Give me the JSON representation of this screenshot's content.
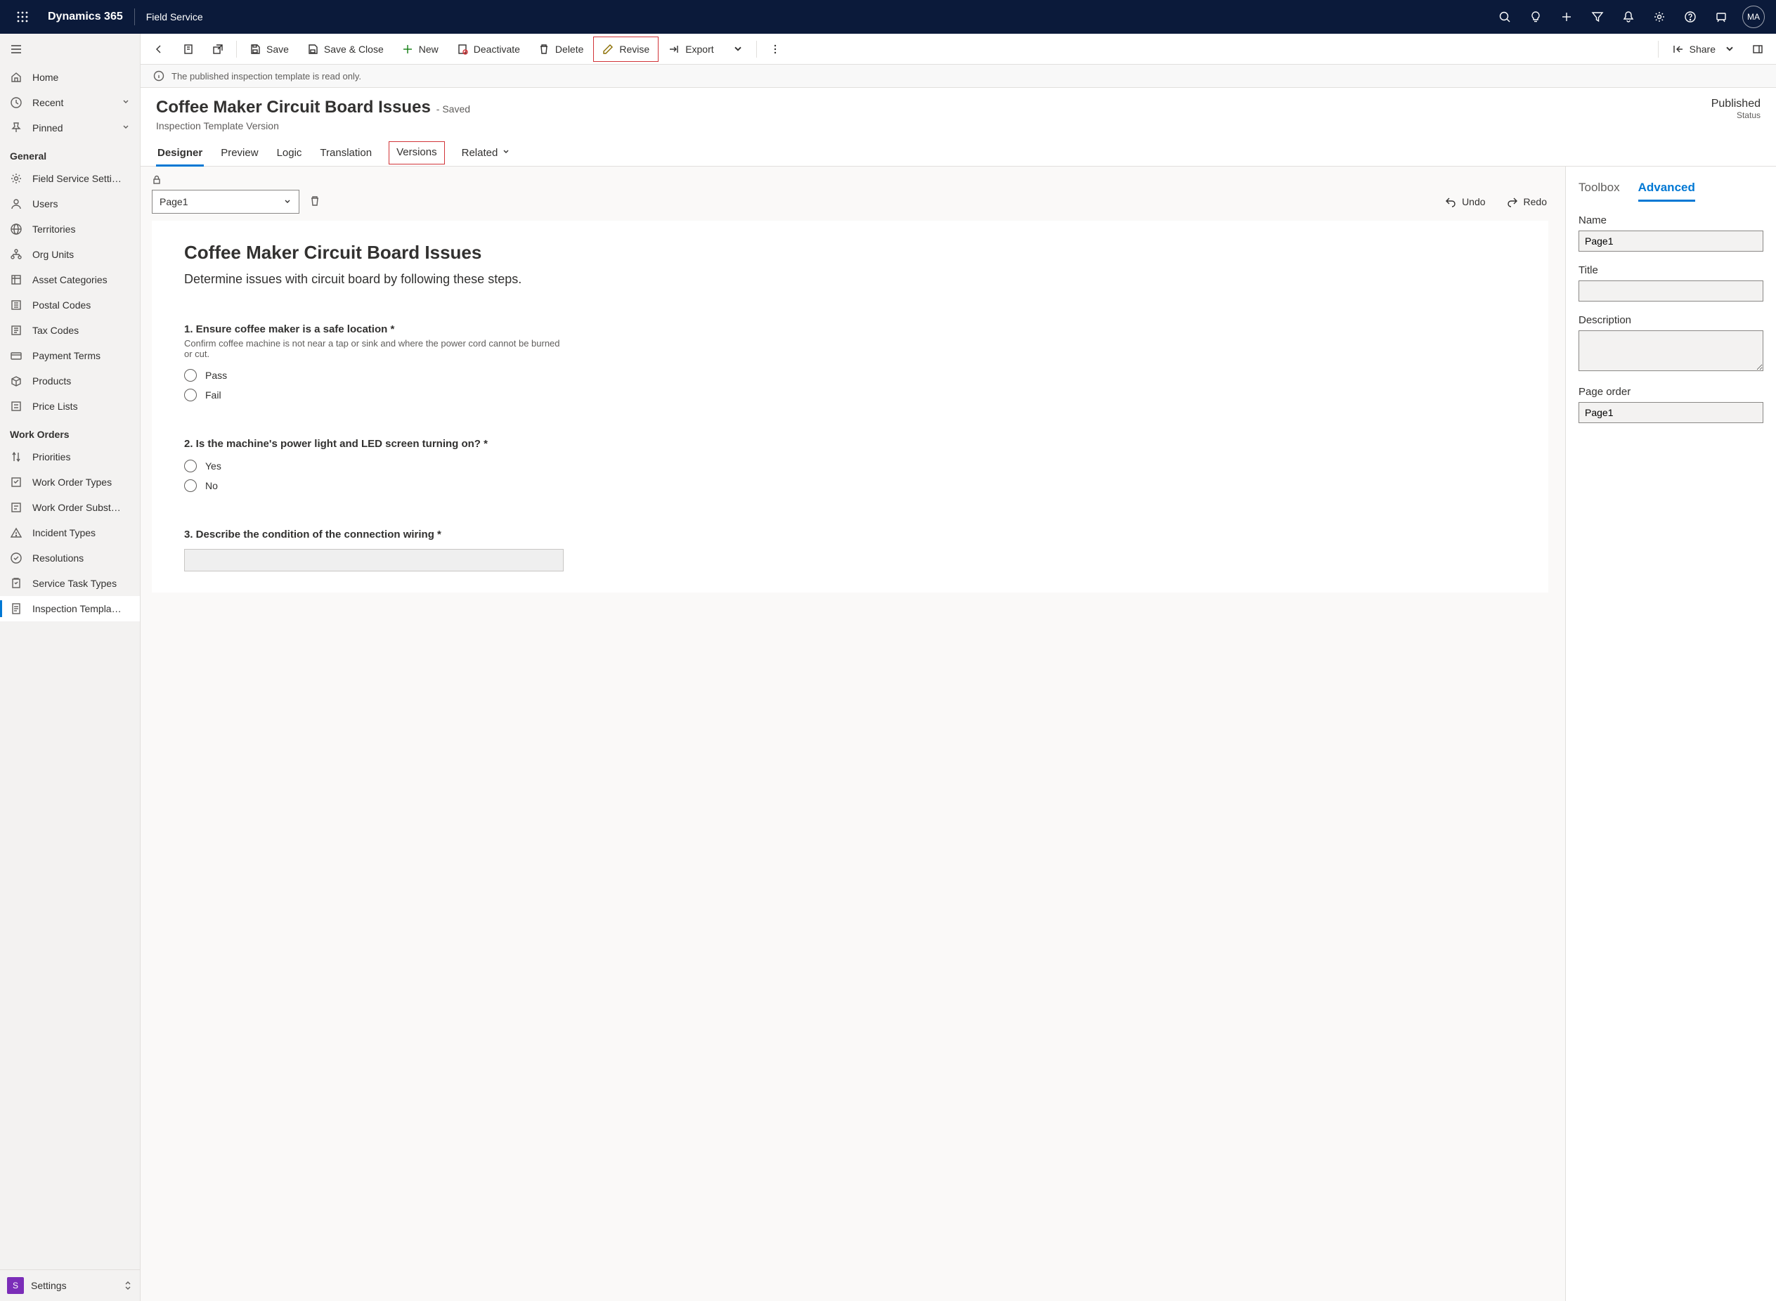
{
  "topnav": {
    "product": "Dynamics 365",
    "module": "Field Service",
    "avatar": "MA"
  },
  "sidebar": {
    "top": [
      {
        "icon": "home",
        "label": "Home"
      },
      {
        "icon": "clock",
        "label": "Recent",
        "expandable": true
      },
      {
        "icon": "pin",
        "label": "Pinned",
        "expandable": true
      }
    ],
    "sections": [
      {
        "title": "General",
        "items": [
          {
            "icon": "gear",
            "label": "Field Service Setti…"
          },
          {
            "icon": "person",
            "label": "Users"
          },
          {
            "icon": "globe",
            "label": "Territories"
          },
          {
            "icon": "org",
            "label": "Org Units"
          },
          {
            "icon": "asset",
            "label": "Asset Categories"
          },
          {
            "icon": "postal",
            "label": "Postal Codes"
          },
          {
            "icon": "tax",
            "label": "Tax Codes"
          },
          {
            "icon": "payment",
            "label": "Payment Terms"
          },
          {
            "icon": "product",
            "label": "Products"
          },
          {
            "icon": "price",
            "label": "Price Lists"
          }
        ]
      },
      {
        "title": "Work Orders",
        "items": [
          {
            "icon": "priority",
            "label": "Priorities"
          },
          {
            "icon": "wotype",
            "label": "Work Order Types"
          },
          {
            "icon": "wosub",
            "label": "Work Order Subst…"
          },
          {
            "icon": "incident",
            "label": "Incident Types"
          },
          {
            "icon": "resolution",
            "label": "Resolutions"
          },
          {
            "icon": "task",
            "label": "Service Task Types"
          },
          {
            "icon": "inspection",
            "label": "Inspection Templa…",
            "active": true
          }
        ]
      }
    ],
    "area": {
      "letter": "S",
      "label": "Settings"
    }
  },
  "commands": {
    "save": "Save",
    "saveclose": "Save & Close",
    "new": "New",
    "deactivate": "Deactivate",
    "delete": "Delete",
    "revise": "Revise",
    "export": "Export",
    "share": "Share"
  },
  "infobar": "The published inspection template is read only.",
  "record": {
    "title": "Coffee Maker Circuit Board Issues",
    "saved": "- Saved",
    "subtitle": "Inspection Template Version",
    "status_value": "Published",
    "status_label": "Status"
  },
  "tabs": [
    "Designer",
    "Preview",
    "Logic",
    "Translation",
    "Versions",
    "Related"
  ],
  "designer": {
    "page_selector": "Page1",
    "undo": "Undo",
    "redo": "Redo",
    "canvas": {
      "title": "Coffee Maker Circuit Board Issues",
      "description": "Determine issues with circuit board by following these steps.",
      "questions": [
        {
          "number": "1.",
          "text": "Ensure coffee maker is a safe location",
          "required": true,
          "help": "Confirm coffee machine is not near a tap or sink and where the power cord cannot be burned or cut.",
          "type": "radio",
          "options": [
            "Pass",
            "Fail"
          ]
        },
        {
          "number": "2.",
          "text": "Is the machine's power light and LED screen turning on?",
          "required": true,
          "type": "radio",
          "options": [
            "Yes",
            "No"
          ]
        },
        {
          "number": "3.",
          "text": "Describe the condition of the connection wiring",
          "required": true,
          "type": "text"
        }
      ]
    }
  },
  "props": {
    "tabs": [
      "Toolbox",
      "Advanced"
    ],
    "fields": {
      "name_label": "Name",
      "name_value": "Page1",
      "title_label": "Title",
      "title_value": "",
      "desc_label": "Description",
      "desc_value": "",
      "order_label": "Page order",
      "order_value": "Page1"
    }
  }
}
